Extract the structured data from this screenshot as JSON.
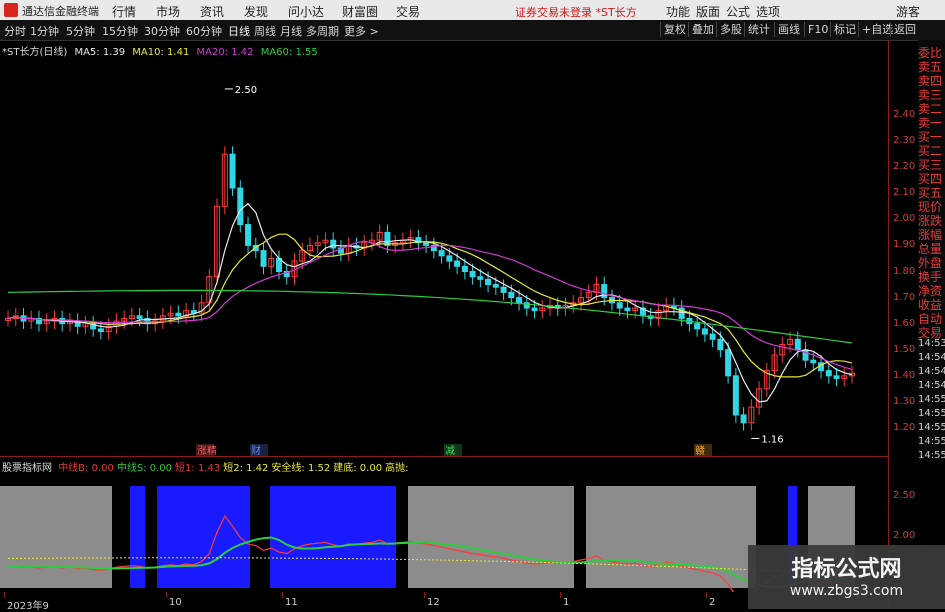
{
  "topbar": {
    "app_name": "通达信金融终端",
    "menus": [
      "行情",
      "市场",
      "资讯",
      "发现",
      "问小达",
      "财富圈",
      "交易"
    ],
    "warning": "证券交易未登录 *ST长方",
    "right_menus": [
      "功能",
      "版面",
      "公式",
      "选项"
    ],
    "guest": "游客"
  },
  "periods": [
    "分时",
    "1分钟",
    "5分钟",
    "15分钟",
    "30分钟",
    "60分钟",
    "日线",
    "周线",
    "月线",
    "多周期",
    "更多 >"
  ],
  "active_period": "日线",
  "right_buttons": [
    "复权",
    "叠加",
    "多股",
    "统计",
    "画线",
    "F10",
    "标记",
    "+自选",
    "返回"
  ],
  "legend": {
    "title": "*ST长方(日线)",
    "ma5": "MA5: 1.39",
    "ma10": "MA10: 1.41",
    "ma20": "MA20: 1.42",
    "ma60": "MA60: 1.55",
    "ma5_color": "#e8e8e8",
    "ma10_color": "#e8e83a",
    "ma20_color": "#d03ad0",
    "ma60_color": "#2ecc40"
  },
  "price_axis": [
    "2.40",
    "2.30",
    "2.20",
    "2.10",
    "2.00",
    "1.90",
    "1.80",
    "1.70",
    "1.60",
    "1.50",
    "1.40",
    "1.30",
    "1.20"
  ],
  "annotations": {
    "high": "2.50",
    "low": "1.16",
    "tags": [
      "涨精",
      "财",
      "减",
      "赣"
    ]
  },
  "sidebar": [
    "委比",
    "卖五",
    "卖四",
    "卖三",
    "卖二",
    "卖一",
    "买一",
    "买二",
    "买三",
    "买四",
    "买五",
    "现价",
    "涨跌",
    "涨幅",
    "总量",
    "外盘",
    "换手",
    "净资",
    "收益",
    "自动",
    "交易",
    "14:53",
    "14:54",
    "14:54",
    "14:54",
    "14:55",
    "14:55",
    "14:55",
    "14:55",
    "14:55"
  ],
  "indicator": {
    "name": "股票指标网",
    "items": [
      {
        "label": "中线B:",
        "value": "0.00",
        "color": "#e23a3a"
      },
      {
        "label": "中线S:",
        "value": "0.00",
        "color": "#2ecc40"
      },
      {
        "label": "短1:",
        "value": "1.43",
        "color": "#e23a3a"
      },
      {
        "label": "短2:",
        "value": "1.42",
        "color": "#e8e83a"
      },
      {
        "label": "安全线:",
        "value": "1.52",
        "color": "#e8e83a"
      },
      {
        "label": "建底:",
        "value": "0.00",
        "color": "#e8e83a"
      },
      {
        "label": "高抛:",
        "value": "",
        "color": "#e8e83a"
      }
    ],
    "axis": [
      "2.50",
      "2.00"
    ]
  },
  "dates": [
    "2023年9",
    "10",
    "11",
    "12",
    "1",
    "2"
  ],
  "watermark": {
    "line1": "指标公式网",
    "line2": "www.zbgs3.com"
  }
}
